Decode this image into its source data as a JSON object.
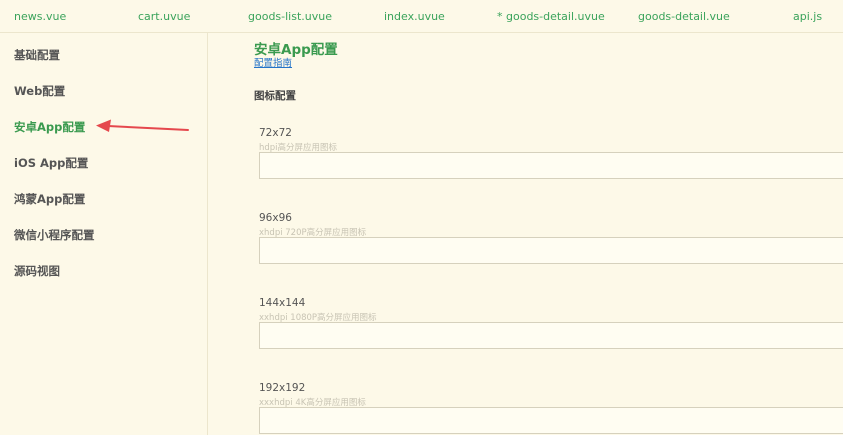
{
  "tabs": [
    {
      "label": "news.vue"
    },
    {
      "label": "cart.uvue"
    },
    {
      "label": "goods-list.uvue"
    },
    {
      "label": "index.uvue"
    },
    {
      "label": "* goods-detail.uvue"
    },
    {
      "label": "goods-detail.vue"
    },
    {
      "label": "api.js"
    }
  ],
  "sidebar": {
    "items": [
      {
        "label": "基础配置",
        "active": false
      },
      {
        "label": "Web配置",
        "active": false
      },
      {
        "label": "安卓App配置",
        "active": true
      },
      {
        "label": "iOS App配置",
        "active": false
      },
      {
        "label": "鸿蒙App配置",
        "active": false
      },
      {
        "label": "微信小程序配置",
        "active": false
      },
      {
        "label": "源码视图",
        "active": false
      }
    ],
    "pointer_icon": "red-arrow-icon"
  },
  "main": {
    "title": "安卓App配置",
    "guide_link": "配置指南",
    "section_title": "图标配置",
    "fields": [
      {
        "label": "72x72",
        "hint": "hdpi高分屏应用图标",
        "value": ""
      },
      {
        "label": "96x96",
        "hint": "xhdpi 720P高分屏应用图标",
        "value": ""
      },
      {
        "label": "144x144",
        "hint": "xxhdpi 1080P高分屏应用图标",
        "value": ""
      },
      {
        "label": "192x192",
        "hint": "xxxhdpi 4K高分屏应用图标",
        "value": ""
      }
    ]
  },
  "colors": {
    "background": "#fdf9e8",
    "accent_green": "#3a9a4f",
    "link_blue": "#2474c9",
    "arrow_red": "#e5484d"
  }
}
